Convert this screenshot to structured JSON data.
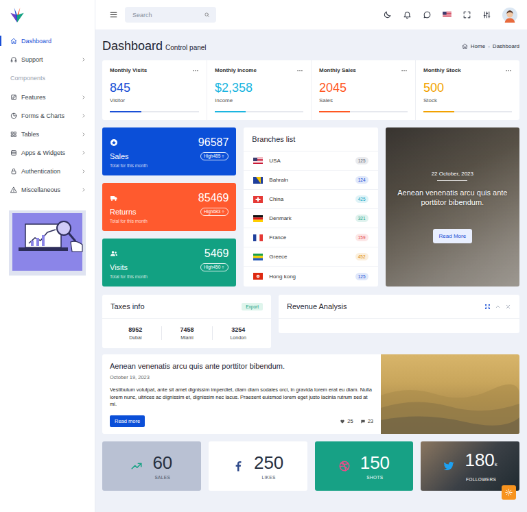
{
  "topbar": {
    "search": {
      "placeholder": "Search"
    }
  },
  "sidebar": {
    "items": [
      {
        "kind": "home",
        "label": "Dashboard",
        "selected": true,
        "expandable": false
      },
      {
        "kind": "headset",
        "label": "Support",
        "selected": false,
        "expandable": true
      },
      {
        "kind": "section",
        "label": "Components",
        "selected": false,
        "expandable": false
      },
      {
        "kind": "edit",
        "label": "Features",
        "selected": false,
        "expandable": true
      },
      {
        "kind": "chart",
        "label": "Forms & Charts",
        "selected": false,
        "expandable": true
      },
      {
        "kind": "grid",
        "label": "Tables",
        "selected": false,
        "expandable": true
      },
      {
        "kind": "stack",
        "label": "Apps & Widgets",
        "selected": false,
        "expandable": true
      },
      {
        "kind": "lock",
        "label": "Authentication",
        "selected": false,
        "expandable": true
      },
      {
        "kind": "warning",
        "label": "Miscellaneous",
        "selected": false,
        "expandable": true
      }
    ]
  },
  "page_header": {
    "title": "Dashboard",
    "subtitle": "Control panel",
    "breadcrumb": [
      "Home",
      "-",
      "Dashboard"
    ]
  },
  "stats": [
    {
      "title": "Monthly Visits",
      "value": "845",
      "label": "Visitor",
      "level": 0.35,
      "color": "#1a4fd6"
    },
    {
      "title": "Monthly Income",
      "value": "$2,358",
      "label": "Income",
      "level": 0.35,
      "color": "#1cb5e0"
    },
    {
      "title": "Monthly Sales",
      "value": "2045",
      "label": "Sales",
      "level": 0.35,
      "color": "#ff5722"
    },
    {
      "title": "Monthly Stock",
      "value": "500",
      "label": "Stock",
      "level": 0.35,
      "color": "#f2a100"
    }
  ],
  "summary_cards": [
    {
      "kind": "star",
      "title": "Sales",
      "value": "96587",
      "badge": "High485",
      "caption": "Total for this month",
      "color": "#0b4fd8"
    },
    {
      "kind": "truck",
      "title": "Returns",
      "value": "85469",
      "badge": "High683",
      "caption": "Total for this month",
      "color": "#ff5a2e"
    },
    {
      "kind": "users",
      "title": "Visits",
      "value": "5469",
      "badge": "High450",
      "caption": "Total for this month",
      "color": "#12a182"
    }
  ],
  "branches": {
    "title": "Branches list",
    "rows": [
      {
        "kind": "us",
        "name": "USA",
        "count": "125",
        "color": "#5b6475"
      },
      {
        "kind": "bh",
        "name": "Bahrain",
        "count": "124",
        "color": "#1a4fd6"
      },
      {
        "kind": "cn",
        "name": "China",
        "count": "425",
        "color": "#0fa3c4"
      },
      {
        "kind": "dk",
        "name": "Denmark",
        "count": "321",
        "color": "#12a182"
      },
      {
        "kind": "fr",
        "name": "France",
        "count": "159",
        "color": "#e5484d"
      },
      {
        "kind": "gr",
        "name": "Greece",
        "count": "452",
        "color": "#e08a00"
      },
      {
        "kind": "hk",
        "name": "Hong kong",
        "count": "125",
        "color": "#1a4fd6"
      }
    ]
  },
  "feature": {
    "date": "22 October, 2023",
    "headline": "Aenean venenatis arcu quis ante porttitor bibendum.",
    "button": "Read More"
  },
  "taxes": {
    "title": "Taxes info",
    "action": "Export",
    "cities": [
      {
        "value": "8952",
        "city": "Dubai"
      },
      {
        "value": "7458",
        "city": "Miami"
      },
      {
        "value": "3254",
        "city": "London"
      }
    ]
  },
  "revenue": {
    "title": "Revenue Analysis"
  },
  "post": {
    "title": "Aenean venenatis arcu quis ante porttitor bibendum.",
    "date": "October 19, 2023",
    "body": "Vestibulum volutpat, ante sit amet dignissim imperdiet, diam diam sodales orci, in gravida lorem erat eu diam. Nulla lorem nunc, ultrices ac dignissim et, dignissim nec lacus. Praesent euismod lorem eget justo lacinia rutrum sed at mi.",
    "button": "Read more",
    "likes": "25",
    "comments": "23"
  },
  "social": [
    {
      "kind": "trend",
      "value": "60",
      "suffix": "",
      "label": "SALES",
      "color": "#b9c1d3"
    },
    {
      "kind": "facebook",
      "value": "250",
      "suffix": "",
      "label": "LIKES",
      "color": "#ffffff"
    },
    {
      "kind": "dribbble",
      "value": "150",
      "suffix": "",
      "label": "SHOTS",
      "color": "#17a185"
    },
    {
      "kind": "twitter",
      "value": "180",
      "suffix": "k",
      "label": "FOLLOWERS",
      "color": "#3b4046"
    }
  ]
}
